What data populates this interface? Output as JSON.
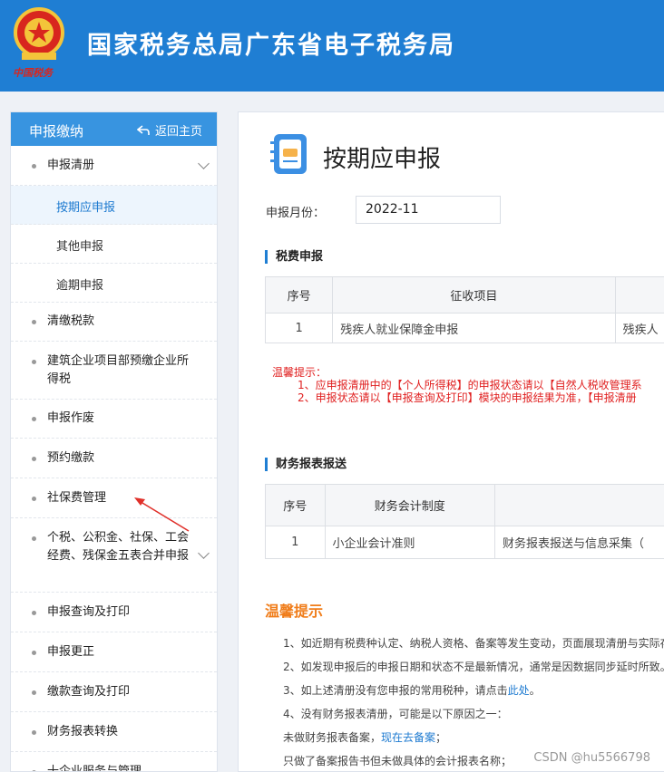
{
  "header": {
    "title": "国家税务总局广东省电子税务局",
    "emblem_text": "中国税务"
  },
  "sidebar": {
    "title": "申报缴纳",
    "home_label": "返回主页",
    "items": [
      {
        "label": "申报清册"
      },
      {
        "label": "按期应申报"
      },
      {
        "label": "其他申报"
      },
      {
        "label": "逾期申报"
      },
      {
        "label": "清缴税款"
      },
      {
        "label": "建筑企业项目部预缴企业所得税"
      },
      {
        "label": "申报作废"
      },
      {
        "label": "预约缴款"
      },
      {
        "label": "社保费管理"
      },
      {
        "label": "个税、公积金、社保、工会经费、残保金五表合并申报"
      },
      {
        "label": "申报查询及打印"
      },
      {
        "label": "申报更正"
      },
      {
        "label": "缴款查询及打印"
      },
      {
        "label": "财务报表转换"
      },
      {
        "label": "十企业服务与管理"
      }
    ]
  },
  "main": {
    "title": "按期应申报",
    "period_label": "申报月份：",
    "period_value": "2022-11",
    "tax_section": {
      "title": "税费申报",
      "headers": [
        "序号",
        "征收项目",
        ""
      ],
      "rows": [
        [
          "1",
          "残疾人就业保障金申报",
          "残疾人"
        ]
      ]
    },
    "notice": {
      "title": "温馨提示：",
      "line1": "1、应申报清册中的【个人所得税】的申报状态请以【自然人税收管理系",
      "line2": "2、申报状态请以【申报查询及打印】模块的申报结果为准，【申报清册"
    },
    "fin_section": {
      "title": "财务报表报送",
      "headers": [
        "序号",
        "财务会计制度",
        ""
      ],
      "rows": [
        [
          "1",
          "小企业会计准则",
          "财务报表报送与信息采集（"
        ]
      ]
    },
    "tips": {
      "title": "温馨提示",
      "t1": "1、如近期有税费种认定、纳税人资格、备案等发生变动，页面展现清册与实际存",
      "t2": "2、如发现申报后的申报日期和状态不是最新情况，通常是因数据同步延时所致。",
      "t3_pre": "3、如上述清册没有您申报的常用税种，请点击",
      "t3_link": "此处",
      "t3_post": "。",
      "t4": "4、没有财务报表清册，可能是以下原因之一：",
      "t5_pre": "未做财务报表备案，",
      "t5_link": "现在去备案",
      "t5_post": "；",
      "t6": "只做了备案报告书但未做具体的会计报表名称；"
    }
  },
  "watermark": "CSDN @hu5566798",
  "colors": {
    "header_blue": "#1f7ed3",
    "accent_orange": "#f07d1a",
    "notice_red": "#e02020"
  }
}
